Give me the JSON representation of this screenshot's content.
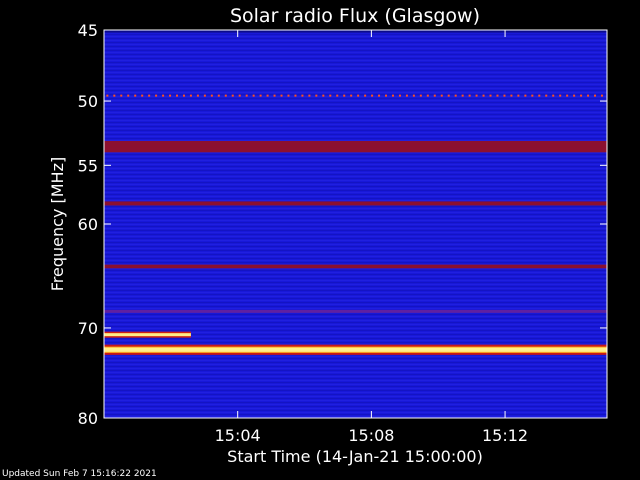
{
  "footer": "Updated Sun Feb  7 15:16:22 2021",
  "chart_data": {
    "type": "heatmap",
    "title": "Solar radio Flux (Glasgow)",
    "xlabel": "Start Time (14-Jan-21 15:00:00)",
    "ylabel": "Frequency [MHz]",
    "x_unit": "minutes after 15:00:00",
    "xlim": [
      0,
      15.05
    ],
    "ylim": [
      45,
      80
    ],
    "y_scale": "log",
    "y_inverted": true,
    "x_ticks": [
      {
        "value": 4,
        "label": "15:04"
      },
      {
        "value": 8,
        "label": "15:08"
      },
      {
        "value": 12,
        "label": "15:12"
      }
    ],
    "y_ticks": [
      {
        "value": 45,
        "label": "45"
      },
      {
        "value": 50,
        "label": "50"
      },
      {
        "value": 55,
        "label": "55"
      },
      {
        "value": 60,
        "label": "60"
      },
      {
        "value": 70,
        "label": "70"
      },
      {
        "value": 80,
        "label": "80"
      }
    ],
    "colors": {
      "background": "#1818d8",
      "dark": "#0a0a8c",
      "medium": "#6020a0",
      "strong": "#8c1030",
      "peak": "#ffee88"
    },
    "features": [
      {
        "kind": "band",
        "freq_mhz": 45.1,
        "width_mhz": 0.15,
        "level": "dark"
      },
      {
        "kind": "band",
        "freq_mhz": 53.5,
        "width_mhz": 0.9,
        "level": "strong"
      },
      {
        "kind": "band",
        "freq_mhz": 58.2,
        "width_mhz": 0.35,
        "level": "strong"
      },
      {
        "kind": "band",
        "freq_mhz": 63.9,
        "width_mhz": 0.35,
        "level": "strong"
      },
      {
        "kind": "band",
        "freq_mhz": 72.3,
        "width_mhz": 0.45,
        "level": "peak"
      },
      {
        "kind": "band",
        "freq_mhz": 68.3,
        "width_mhz": 0.3,
        "level": "medium"
      },
      {
        "kind": "segment",
        "freq_mhz": 70.7,
        "t_start": 0,
        "t_end": 2.6,
        "level": "peak"
      },
      {
        "kind": "dotted_line",
        "freq_mhz": 49.6,
        "t_start": 0.1,
        "t_end": 14.9,
        "level": "strong"
      }
    ]
  }
}
